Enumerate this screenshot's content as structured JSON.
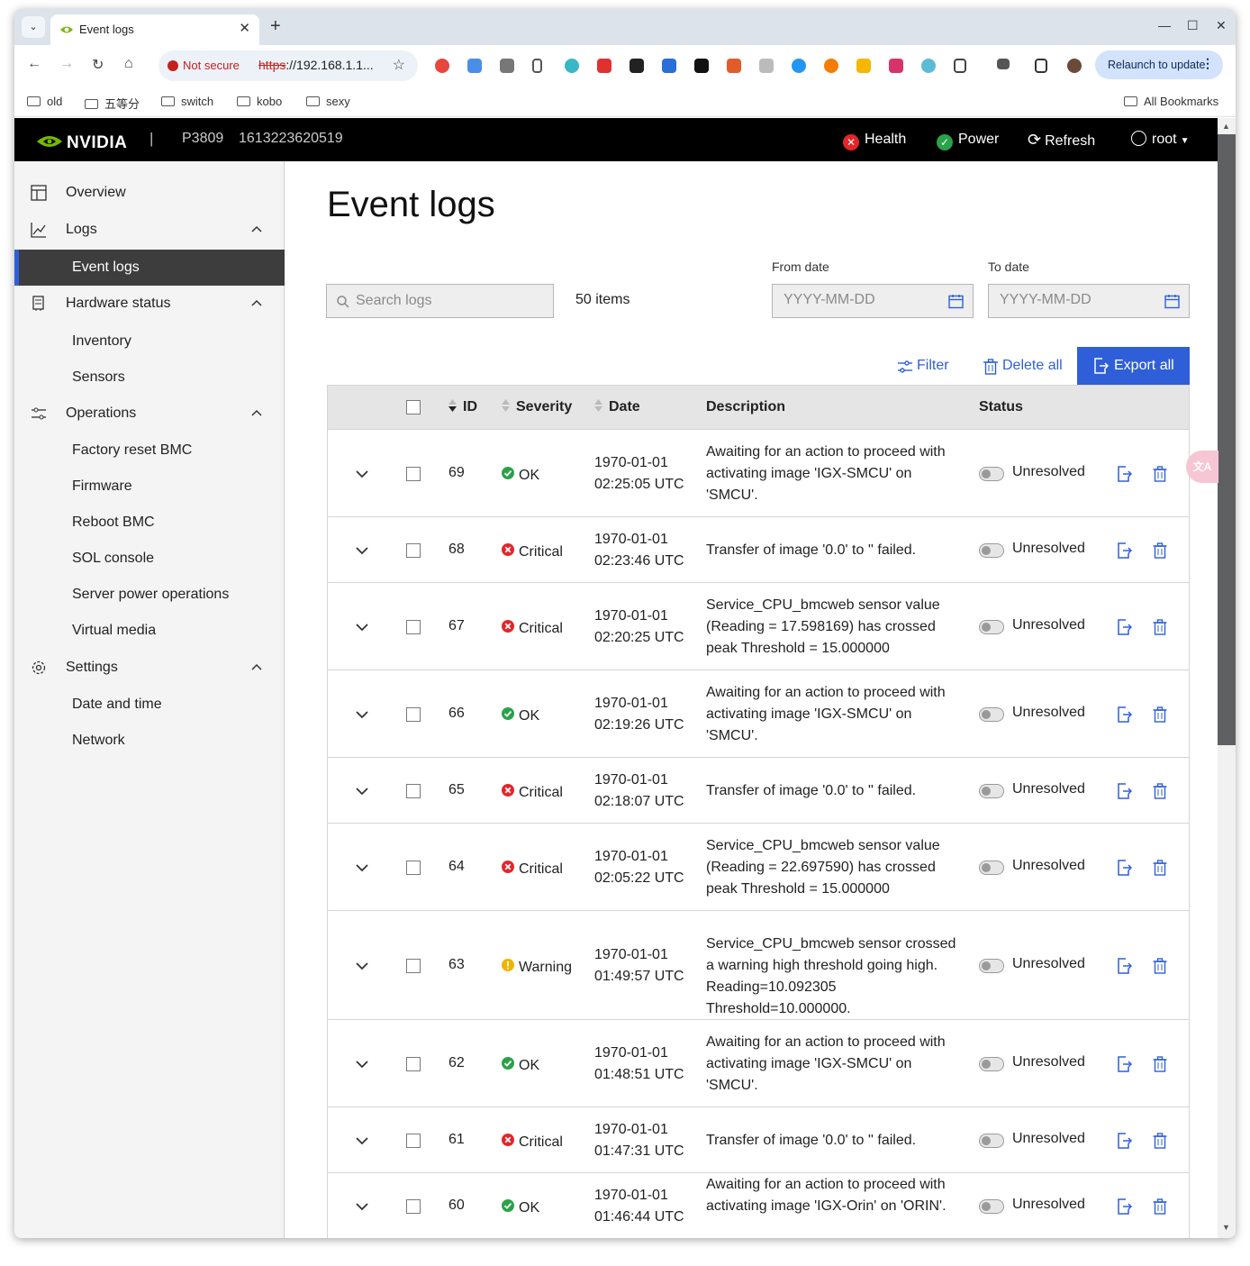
{
  "browser": {
    "tab_title": "Event logs",
    "not_secure": "Not secure",
    "url_scheme": "https",
    "url_rest": "://192.168.1.1...",
    "relaunch": "Relaunch to update",
    "all_bookmarks": "All Bookmarks",
    "bookmarks": [
      "old",
      "五等分",
      "switch",
      "kobo",
      "sexy"
    ]
  },
  "header": {
    "logo": "NVIDIA",
    "model": "P3809",
    "serial": "1613223620519",
    "health": "Health",
    "power": "Power",
    "refresh": "Refresh",
    "user": "root",
    "colors": {
      "health": "#e5252a",
      "power": "#2aa24a"
    }
  },
  "sidebar": {
    "overview": "Overview",
    "logs": "Logs",
    "event_logs": "Event logs",
    "hardware_status": "Hardware status",
    "inventory": "Inventory",
    "sensors": "Sensors",
    "operations": "Operations",
    "factory_reset": "Factory reset BMC",
    "firmware": "Firmware",
    "reboot": "Reboot BMC",
    "sol": "SOL console",
    "server_power": "Server power operations",
    "virtual_media": "Virtual media",
    "settings": "Settings",
    "date_time": "Date and time",
    "network": "Network"
  },
  "main": {
    "title": "Event logs",
    "search_placeholder": "Search logs",
    "items_count": "50 items",
    "from_date": "From date",
    "to_date": "To date",
    "date_placeholder": "YYYY-MM-DD",
    "filter": "Filter",
    "delete_all": "Delete all",
    "export_all": "Export all",
    "columns": {
      "id": "ID",
      "severity": "Severity",
      "date": "Date",
      "description": "Description",
      "status": "Status"
    },
    "accent": "#2f5fd8",
    "rows": [
      {
        "id": "69",
        "severity": "OK",
        "date1": "1970-01-01",
        "date2": "02:25:05 UTC",
        "description": "Awaiting for an action to proceed with activating image 'IGX-SMCU' on 'SMCU'.",
        "status": "Unresolved"
      },
      {
        "id": "68",
        "severity": "Critical",
        "date1": "1970-01-01",
        "date2": "02:23:46 UTC",
        "description": "Transfer of image '0.0' to '' failed.",
        "status": "Unresolved"
      },
      {
        "id": "67",
        "severity": "Critical",
        "date1": "1970-01-01",
        "date2": "02:20:25 UTC",
        "description": "Service_CPU_bmcweb sensor value (Reading = 17.598169) has crossed peak Threshold = 15.000000",
        "status": "Unresolved"
      },
      {
        "id": "66",
        "severity": "OK",
        "date1": "1970-01-01",
        "date2": "02:19:26 UTC",
        "description": "Awaiting for an action to proceed with activating image 'IGX-SMCU' on 'SMCU'.",
        "status": "Unresolved"
      },
      {
        "id": "65",
        "severity": "Critical",
        "date1": "1970-01-01",
        "date2": "02:18:07 UTC",
        "description": "Transfer of image '0.0' to '' failed.",
        "status": "Unresolved"
      },
      {
        "id": "64",
        "severity": "Critical",
        "date1": "1970-01-01",
        "date2": "02:05:22 UTC",
        "description": "Service_CPU_bmcweb sensor value (Reading = 22.697590) has crossed peak Threshold = 15.000000",
        "status": "Unresolved"
      },
      {
        "id": "63",
        "severity": "Warning",
        "date1": "1970-01-01",
        "date2": "01:49:57 UTC",
        "description": "Service_CPU_bmcweb sensor crossed a warning high threshold going high. Reading=10.092305 Threshold=10.000000.",
        "status": "Unresolved"
      },
      {
        "id": "62",
        "severity": "OK",
        "date1": "1970-01-01",
        "date2": "01:48:51 UTC",
        "description": "Awaiting for an action to proceed with activating image 'IGX-SMCU' on 'SMCU'.",
        "status": "Unresolved"
      },
      {
        "id": "61",
        "severity": "Critical",
        "date1": "1970-01-01",
        "date2": "01:47:31 UTC",
        "description": "Transfer of image '0.0' to '' failed.",
        "status": "Unresolved"
      },
      {
        "id": "60",
        "severity": "OK",
        "date1": "1970-01-01",
        "date2": "01:46:44 UTC",
        "description": "Awaiting for an action to proceed with activating image 'IGX-Orin' on 'ORIN'.",
        "status": "Unresolved"
      }
    ]
  },
  "severity_colors": {
    "OK": "#2aa24a",
    "Critical": "#e5252a",
    "Warning": "#f0b400"
  },
  "translate_fab": "文A"
}
